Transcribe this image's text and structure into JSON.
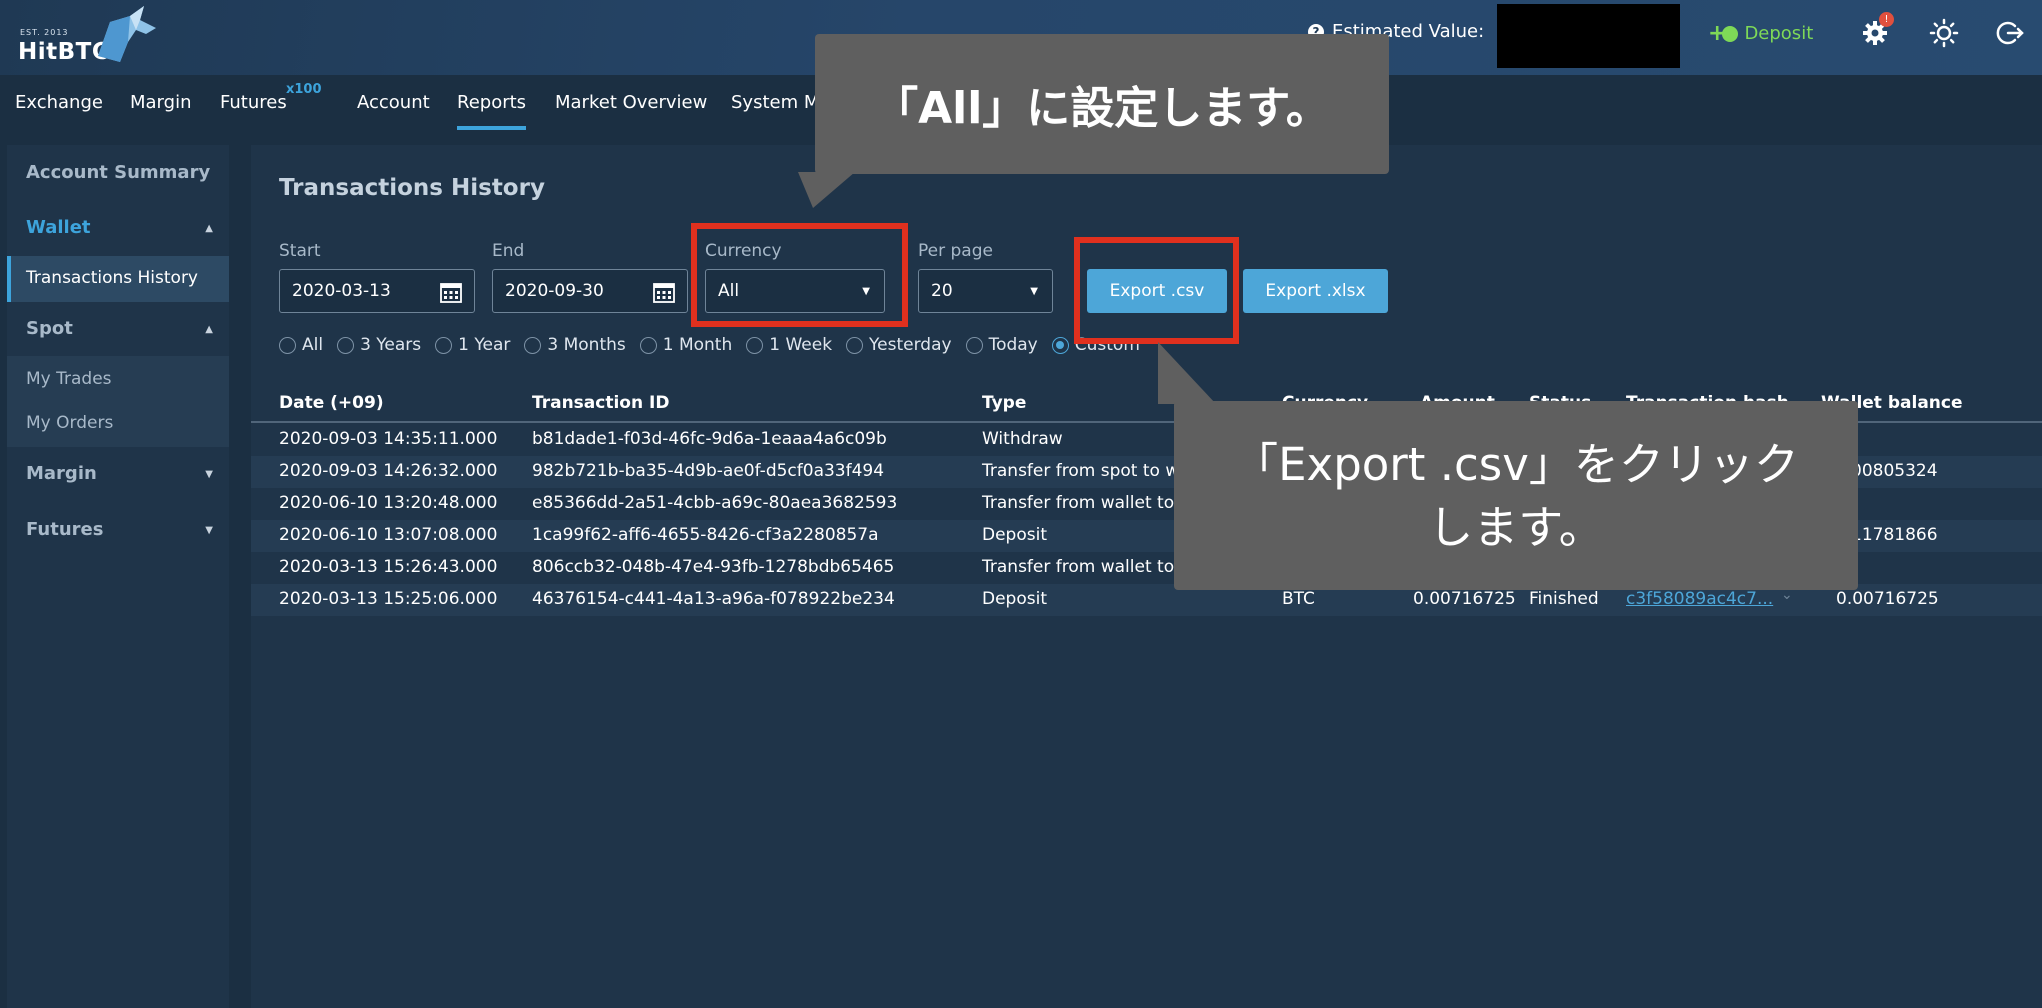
{
  "header": {
    "logo_est": "EST. 2013",
    "logo_brand": "HitBTC",
    "estimated_value_label": "Estimated Value:",
    "deposit_label": "Deposit",
    "notification_badge": "!"
  },
  "nav": {
    "items": [
      "Exchange",
      "Margin",
      "Futures",
      "Account",
      "Reports",
      "Market Overview",
      "System M"
    ],
    "futures_sup": "x100",
    "active": "Reports"
  },
  "sidebar": {
    "account_summary": "Account Summary",
    "wallet": "Wallet",
    "transactions_history": "Transactions History",
    "spot": "Spot",
    "my_trades": "My Trades",
    "my_orders": "My Orders",
    "margin": "Margin",
    "futures": "Futures"
  },
  "main": {
    "title": "Transactions History",
    "start_label": "Start",
    "start_value": "2020-03-13",
    "end_label": "End",
    "end_value": "2020-09-30",
    "currency_label": "Currency",
    "currency_value": "All",
    "perpage_label": "Per page",
    "perpage_value": "20",
    "export_csv": "Export .csv",
    "export_xlsx": "Export .xlsx",
    "ranges": [
      "All",
      "3 Years",
      "1 Year",
      "3 Months",
      "1 Month",
      "1 Week",
      "Yesterday",
      "Today",
      "Custom"
    ],
    "selected_range": "Custom"
  },
  "table": {
    "columns": [
      "Date (+09)",
      "Transaction ID",
      "Type",
      "Currency",
      "Amount",
      "Status",
      "Transaction hash",
      "Wallet balance"
    ],
    "rows": [
      {
        "date": "2020-09-03 14:35:11.000",
        "id": "b81dade1-f03d-46fc-9d6a-1eaaa4a6c09b",
        "type": "Withdraw",
        "balance": ""
      },
      {
        "date": "2020-09-03 14:26:32.000",
        "id": "982b721b-ba35-4d9b-ae0f-d5cf0a33f494",
        "type": "Transfer from spot to w",
        "balance": "00805324"
      },
      {
        "date": "2020-06-10 13:20:48.000",
        "id": "e85366dd-2a51-4cbb-a69c-80aea3682593",
        "type": "Transfer from wallet to",
        "balance": ""
      },
      {
        "date": "2020-06-10 13:07:08.000",
        "id": "1ca99f62-aff6-4655-8426-cf3a2280857a",
        "type": "Deposit",
        "balance": "11781866"
      },
      {
        "date": "2020-03-13 15:26:43.000",
        "id": "806ccb32-048b-47e4-93fb-1278bdb65465",
        "type": "Transfer from wallet to",
        "balance": ""
      },
      {
        "date": "2020-03-13 15:25:06.000",
        "id": "46376154-c441-4a13-a96a-f078922be234",
        "type": "Deposit",
        "currency": "BTC",
        "amount": "0.00716725",
        "status": "Finished",
        "hash": "c3f58089ac4c7...",
        "balance": "0.00716725"
      }
    ]
  },
  "callouts": {
    "currency_note": "「All」に設定します。",
    "export_note_line1": "「Export .csv」をクリック",
    "export_note_line2": "します。"
  },
  "colors": {
    "accent": "#3da4dc",
    "button": "#4da6d8",
    "deposit": "#7ed957",
    "highlight": "#e0301e",
    "callout_bg": "#5f5f5f"
  }
}
